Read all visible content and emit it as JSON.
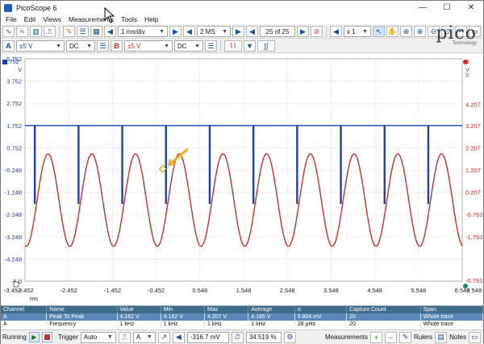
{
  "window": {
    "title": "PicoScope 6",
    "minimize": "—",
    "maximize": "☐",
    "close": "✕"
  },
  "menu": [
    "File",
    "Edit",
    "Views",
    "Measurements",
    "Tools",
    "Help"
  ],
  "toolbar1": {
    "timebase": "1 ms/div",
    "samples": "2 MS",
    "buffer": "25 of 25",
    "zoom": "x 1"
  },
  "toolbar2": {
    "chA_label": "A",
    "chA_range": "±5 V",
    "chA_coupling": "DC",
    "chB_label": "B",
    "chB_range": "±5 V",
    "chB_coupling": "DC"
  },
  "logo": {
    "text": "pico",
    "subtitle": "Technology"
  },
  "colors": {
    "chA": "#1a3fb8",
    "chB": "#d42a2a",
    "annotation": "#f0b429",
    "gridline": "#c8c8c8"
  },
  "chart_data": {
    "type": "line",
    "x": [
      -3.452,
      6.548
    ],
    "xlim": [
      -3.452,
      6.548
    ],
    "xlabel": "ms",
    "x_ticks": [
      "-3.452",
      "-2.452",
      "-1.452",
      "-0.452",
      "0.548",
      "1.548",
      "2.548",
      "3.548",
      "4.548",
      "5.548",
      "6.548"
    ],
    "left_axis": {
      "unit": "V",
      "ticks": [
        "5.752",
        "2.752",
        "2.752",
        "1.752",
        "0.752",
        "-0.248",
        "-1.248",
        "-2.248",
        "-3.248",
        "-4.248",
        "-5.0"
      ],
      "display_ticks": [
        "5.752",
        "3.752",
        "2.752",
        "1.752",
        "0.752",
        "-0.248",
        "-1.248",
        "-2.248",
        "-3.248",
        "-4.248",
        "-5.0"
      ]
    },
    "right_axis": {
      "unit": "V",
      "ticks": [
        "5",
        "4.207",
        "3.207",
        "2.207",
        "1.207",
        "0.207",
        "-0.793",
        "-1.793"
      ]
    },
    "series": [
      {
        "channel": "A",
        "color": "#1a3fb8",
        "form": "pulse",
        "high_v": 1.752,
        "low_v": -1.75,
        "period_ms": 1.0,
        "pulse_times_ms": [
          -3.2,
          -2.2,
          -1.2,
          -0.2,
          0.8,
          1.8,
          2.8,
          3.8,
          4.8,
          5.8
        ]
      },
      {
        "channel": "B",
        "color": "#d42a2a",
        "form": "sine",
        "frequency_khz": 1,
        "peak_to_peak_v": 4.162,
        "offset_v": 0.15
      }
    ],
    "annotation": {
      "type": "arrow",
      "x_ms": -0.3,
      "y_v": -0.2
    }
  },
  "plot_labels": {
    "left_unit": "V",
    "right_unit": "V",
    "right_top": "5",
    "x_unit": "ms",
    "corner_tl": "5.752",
    "corner_bl": "-3.452",
    "corner_br": "6.548",
    "corner_br_value": "-0.793"
  },
  "measurements": {
    "headers": [
      "Channel",
      "Name",
      "Value",
      "Min",
      "Max",
      "Average",
      "σ",
      "Capture Count",
      "Span"
    ],
    "rows": [
      [
        "A",
        "Peak To Peak",
        "4.162 V",
        "4.162 V",
        "4.207 V",
        "4.185 V",
        "9.804 mV",
        "20",
        "Whole trace"
      ],
      [
        "A",
        "Frequency",
        "1 kHz",
        "1 kHz",
        "1 kHz",
        "1 kHz",
        "28 μHz",
        "20",
        "Whole trace"
      ]
    ]
  },
  "status": {
    "run_state": "Running",
    "trigger_label": "Trigger",
    "trigger_mode": "Auto",
    "trigger_channel": "A",
    "trigger_level": "-316.7 mV",
    "pretrigger": "34.519 %",
    "measurements_label": "Measurements",
    "rulers_label": "Rulers",
    "notes_label": "Notes"
  }
}
